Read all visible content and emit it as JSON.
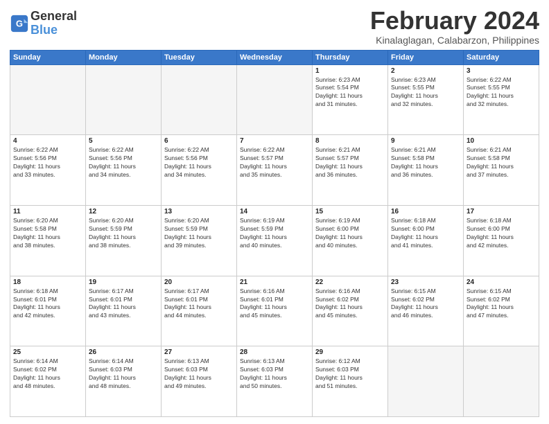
{
  "header": {
    "logo_line1": "General",
    "logo_line2": "Blue",
    "month": "February 2024",
    "location": "Kinalaglagan, Calabarzon, Philippines"
  },
  "days_of_week": [
    "Sunday",
    "Monday",
    "Tuesday",
    "Wednesday",
    "Thursday",
    "Friday",
    "Saturday"
  ],
  "weeks": [
    [
      {
        "num": "",
        "info": "",
        "empty": true
      },
      {
        "num": "",
        "info": "",
        "empty": true
      },
      {
        "num": "",
        "info": "",
        "empty": true
      },
      {
        "num": "",
        "info": "",
        "empty": true
      },
      {
        "num": "1",
        "info": "Sunrise: 6:23 AM\nSunset: 5:54 PM\nDaylight: 11 hours\nand 31 minutes."
      },
      {
        "num": "2",
        "info": "Sunrise: 6:23 AM\nSunset: 5:55 PM\nDaylight: 11 hours\nand 32 minutes."
      },
      {
        "num": "3",
        "info": "Sunrise: 6:22 AM\nSunset: 5:55 PM\nDaylight: 11 hours\nand 32 minutes."
      }
    ],
    [
      {
        "num": "4",
        "info": "Sunrise: 6:22 AM\nSunset: 5:56 PM\nDaylight: 11 hours\nand 33 minutes."
      },
      {
        "num": "5",
        "info": "Sunrise: 6:22 AM\nSunset: 5:56 PM\nDaylight: 11 hours\nand 34 minutes."
      },
      {
        "num": "6",
        "info": "Sunrise: 6:22 AM\nSunset: 5:56 PM\nDaylight: 11 hours\nand 34 minutes."
      },
      {
        "num": "7",
        "info": "Sunrise: 6:22 AM\nSunset: 5:57 PM\nDaylight: 11 hours\nand 35 minutes."
      },
      {
        "num": "8",
        "info": "Sunrise: 6:21 AM\nSunset: 5:57 PM\nDaylight: 11 hours\nand 36 minutes."
      },
      {
        "num": "9",
        "info": "Sunrise: 6:21 AM\nSunset: 5:58 PM\nDaylight: 11 hours\nand 36 minutes."
      },
      {
        "num": "10",
        "info": "Sunrise: 6:21 AM\nSunset: 5:58 PM\nDaylight: 11 hours\nand 37 minutes."
      }
    ],
    [
      {
        "num": "11",
        "info": "Sunrise: 6:20 AM\nSunset: 5:58 PM\nDaylight: 11 hours\nand 38 minutes."
      },
      {
        "num": "12",
        "info": "Sunrise: 6:20 AM\nSunset: 5:59 PM\nDaylight: 11 hours\nand 38 minutes."
      },
      {
        "num": "13",
        "info": "Sunrise: 6:20 AM\nSunset: 5:59 PM\nDaylight: 11 hours\nand 39 minutes."
      },
      {
        "num": "14",
        "info": "Sunrise: 6:19 AM\nSunset: 5:59 PM\nDaylight: 11 hours\nand 40 minutes."
      },
      {
        "num": "15",
        "info": "Sunrise: 6:19 AM\nSunset: 6:00 PM\nDaylight: 11 hours\nand 40 minutes."
      },
      {
        "num": "16",
        "info": "Sunrise: 6:18 AM\nSunset: 6:00 PM\nDaylight: 11 hours\nand 41 minutes."
      },
      {
        "num": "17",
        "info": "Sunrise: 6:18 AM\nSunset: 6:00 PM\nDaylight: 11 hours\nand 42 minutes."
      }
    ],
    [
      {
        "num": "18",
        "info": "Sunrise: 6:18 AM\nSunset: 6:01 PM\nDaylight: 11 hours\nand 42 minutes."
      },
      {
        "num": "19",
        "info": "Sunrise: 6:17 AM\nSunset: 6:01 PM\nDaylight: 11 hours\nand 43 minutes."
      },
      {
        "num": "20",
        "info": "Sunrise: 6:17 AM\nSunset: 6:01 PM\nDaylight: 11 hours\nand 44 minutes."
      },
      {
        "num": "21",
        "info": "Sunrise: 6:16 AM\nSunset: 6:01 PM\nDaylight: 11 hours\nand 45 minutes."
      },
      {
        "num": "22",
        "info": "Sunrise: 6:16 AM\nSunset: 6:02 PM\nDaylight: 11 hours\nand 45 minutes."
      },
      {
        "num": "23",
        "info": "Sunrise: 6:15 AM\nSunset: 6:02 PM\nDaylight: 11 hours\nand 46 minutes."
      },
      {
        "num": "24",
        "info": "Sunrise: 6:15 AM\nSunset: 6:02 PM\nDaylight: 11 hours\nand 47 minutes."
      }
    ],
    [
      {
        "num": "25",
        "info": "Sunrise: 6:14 AM\nSunset: 6:02 PM\nDaylight: 11 hours\nand 48 minutes."
      },
      {
        "num": "26",
        "info": "Sunrise: 6:14 AM\nSunset: 6:03 PM\nDaylight: 11 hours\nand 48 minutes."
      },
      {
        "num": "27",
        "info": "Sunrise: 6:13 AM\nSunset: 6:03 PM\nDaylight: 11 hours\nand 49 minutes."
      },
      {
        "num": "28",
        "info": "Sunrise: 6:13 AM\nSunset: 6:03 PM\nDaylight: 11 hours\nand 50 minutes."
      },
      {
        "num": "29",
        "info": "Sunrise: 6:12 AM\nSunset: 6:03 PM\nDaylight: 11 hours\nand 51 minutes."
      },
      {
        "num": "",
        "info": "",
        "empty": true
      },
      {
        "num": "",
        "info": "",
        "empty": true
      }
    ]
  ]
}
